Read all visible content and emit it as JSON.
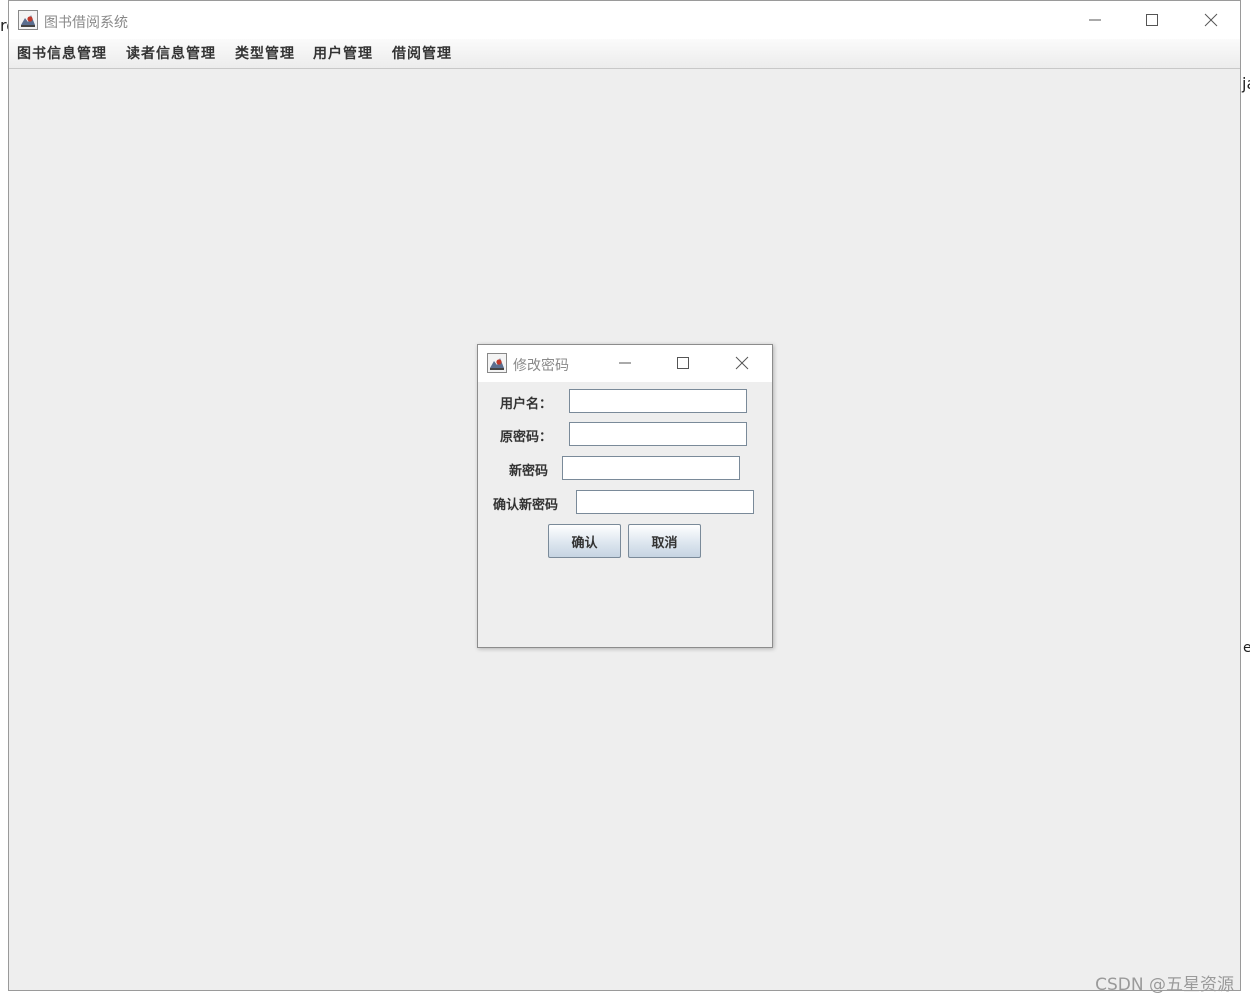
{
  "background": {
    "left_fragment": "ro",
    "right_fragments": [
      "ja",
      "e"
    ]
  },
  "main_window": {
    "title": "图书借阅系统",
    "icon": "java-coffee-icon",
    "controls": {
      "minimize": "minimize-icon",
      "maximize": "maximize-icon",
      "close": "close-icon"
    }
  },
  "menubar": {
    "items": [
      {
        "label": "图书信息管理"
      },
      {
        "label": "读者信息管理"
      },
      {
        "label": "类型管理"
      },
      {
        "label": "用户管理"
      },
      {
        "label": "借阅管理"
      }
    ]
  },
  "dialog": {
    "title": "修改密码",
    "icon": "java-coffee-icon",
    "fields": [
      {
        "label": "用户名：",
        "value": "",
        "placeholder": ""
      },
      {
        "label": "原密码：",
        "value": "",
        "placeholder": ""
      },
      {
        "label": "新密码",
        "value": "",
        "placeholder": ""
      },
      {
        "label": "确认新密码",
        "value": "",
        "placeholder": ""
      }
    ],
    "confirm_label": "确认",
    "cancel_label": "取消"
  },
  "watermark": "CSDN @五星资源",
  "colors": {
    "window_bg": "#eeeeee",
    "title_text": "#8a8a8a",
    "button_gradient_bottom": "#c6d4e2",
    "input_border": "#7a8a99"
  }
}
